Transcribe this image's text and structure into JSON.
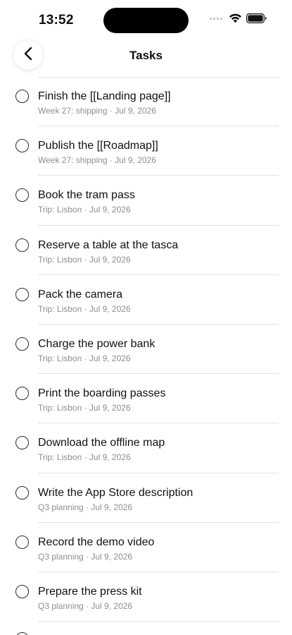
{
  "status_bar": {
    "time": "13:52"
  },
  "nav": {
    "title": "Tasks",
    "back_icon": "chevron-left-icon"
  },
  "tasks": [
    {
      "title": "Finish the [[Landing page]]",
      "meta": "Week 27: shipping · Jul 9, 2026",
      "completed": false
    },
    {
      "title": "Publish the [[Roadmap]]",
      "meta": "Week 27: shipping · Jul 9, 2026",
      "completed": false
    },
    {
      "title": "Book the tram pass",
      "meta": "Trip: Lisbon · Jul 9, 2026",
      "completed": false
    },
    {
      "title": "Reserve a table at the tasca",
      "meta": "Trip: Lisbon · Jul 9, 2026",
      "completed": false
    },
    {
      "title": "Pack the camera",
      "meta": "Trip: Lisbon · Jul 9, 2026",
      "completed": false
    },
    {
      "title": "Charge the power bank",
      "meta": "Trip: Lisbon · Jul 9, 2026",
      "completed": false
    },
    {
      "title": "Print the boarding passes",
      "meta": "Trip: Lisbon · Jul 9, 2026",
      "completed": false
    },
    {
      "title": "Download the offline map",
      "meta": "Trip: Lisbon · Jul 9, 2026",
      "completed": false
    },
    {
      "title": "Write the App Store description",
      "meta": "Q3 planning · Jul 9, 2026",
      "completed": false
    },
    {
      "title": "Record the demo video",
      "meta": "Q3 planning · Jul 9, 2026",
      "completed": false
    },
    {
      "title": "Prepare the press kit",
      "meta": "Q3 planning · Jul 9, 2026",
      "completed": false
    }
  ]
}
